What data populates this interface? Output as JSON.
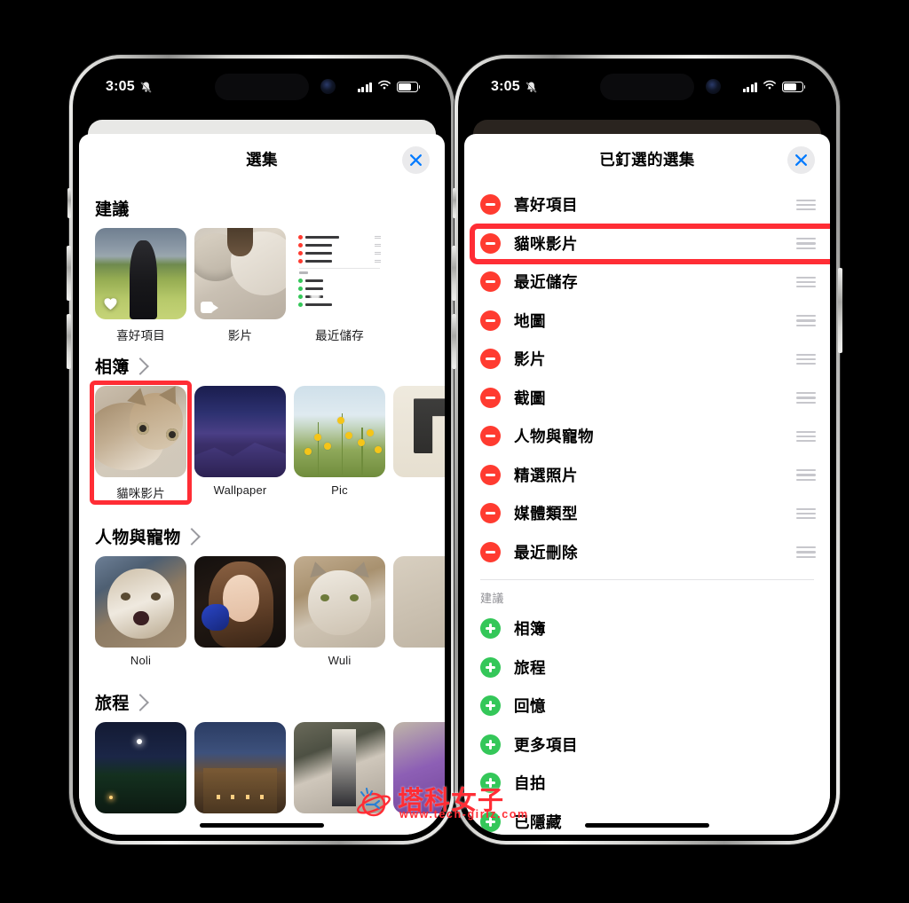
{
  "status_bar": {
    "time": "3:05",
    "icons": [
      "silent-mode-icon",
      "signal-icon",
      "wifi-icon",
      "battery-icon"
    ]
  },
  "left_phone": {
    "sheet": {
      "title": "選集",
      "close_label": "×"
    },
    "sections": [
      {
        "title": "建議",
        "has_chevron": false,
        "items": [
          {
            "label": "喜好項目",
            "thumb": "favorites-field-photo",
            "overlay": "heart-icon"
          },
          {
            "label": "影片",
            "thumb": "video-cat-photo",
            "overlay": "video-camera-icon"
          },
          {
            "label": "最近儲存",
            "thumb": "recent-saved-screenshot",
            "overlay": ""
          }
        ]
      },
      {
        "title": "相簿",
        "has_chevron": true,
        "items": [
          {
            "label": "貓咪影片",
            "thumb": "cat-photo",
            "overlay": "",
            "highlighted": true
          },
          {
            "label": "Wallpaper",
            "thumb": "wallpaper-mountain",
            "overlay": ""
          },
          {
            "label": "Pic",
            "thumb": "yellow-flowers",
            "overlay": ""
          },
          {
            "label": "",
            "thumb": "book-page-partial",
            "overlay": ""
          }
        ]
      },
      {
        "title": "人物與寵物",
        "has_chevron": true,
        "items": [
          {
            "label": "Noli",
            "thumb": "cat-noli",
            "overlay": ""
          },
          {
            "label": "",
            "thumb": "person-with-mic",
            "overlay": ""
          },
          {
            "label": "Wuli",
            "thumb": "cat-wuli",
            "overlay": ""
          },
          {
            "label": "",
            "thumb": "partial-thumb",
            "overlay": ""
          }
        ]
      },
      {
        "title": "旅程",
        "has_chevron": true,
        "items": [
          {
            "label": "",
            "thumb": "night-scene",
            "overlay": ""
          },
          {
            "label": "",
            "thumb": "night-building",
            "overlay": ""
          },
          {
            "label": "",
            "thumb": "clothes-rack",
            "overlay": ""
          },
          {
            "label": "",
            "thumb": "purple-partial",
            "overlay": ""
          }
        ]
      }
    ],
    "mini_list_preview": {
      "pinned": [
        "人物與寵物",
        "精選照片",
        "媒體類型",
        "最近刪除"
      ],
      "suggested_header": "建議",
      "suggested": [
        "相簿",
        "旅程",
        "回憶",
        "更多項目"
      ]
    }
  },
  "right_phone": {
    "sheet": {
      "title": "已釘選的選集",
      "close_label": "×"
    },
    "pinned_items": [
      {
        "label": "喜好項目",
        "action": "remove",
        "highlighted": false
      },
      {
        "label": "貓咪影片",
        "action": "remove",
        "highlighted": true
      },
      {
        "label": "最近儲存",
        "action": "remove",
        "highlighted": false
      },
      {
        "label": "地圖",
        "action": "remove",
        "highlighted": false
      },
      {
        "label": "影片",
        "action": "remove",
        "highlighted": false
      },
      {
        "label": "截圖",
        "action": "remove",
        "highlighted": false
      },
      {
        "label": "人物與寵物",
        "action": "remove",
        "highlighted": false
      },
      {
        "label": "精選照片",
        "action": "remove",
        "highlighted": false
      },
      {
        "label": "媒體類型",
        "action": "remove",
        "highlighted": false
      },
      {
        "label": "最近刪除",
        "action": "remove",
        "highlighted": false
      }
    ],
    "suggested_header": "建議",
    "suggested_items": [
      {
        "label": "相簿",
        "action": "add"
      },
      {
        "label": "旅程",
        "action": "add"
      },
      {
        "label": "回憶",
        "action": "add"
      },
      {
        "label": "更多項目",
        "action": "add"
      },
      {
        "label": "自拍",
        "action": "add"
      },
      {
        "label": "已隱藏",
        "action": "add"
      }
    ]
  },
  "watermark": {
    "brand": "塔科女子",
    "url": "www.tech-girlz.com"
  },
  "colors": {
    "accent_blue": "#007aff",
    "remove_red": "#ff3b30",
    "add_green": "#34c759",
    "highlight_red": "#ff2d35",
    "sheet_bg": "#ffffff"
  }
}
